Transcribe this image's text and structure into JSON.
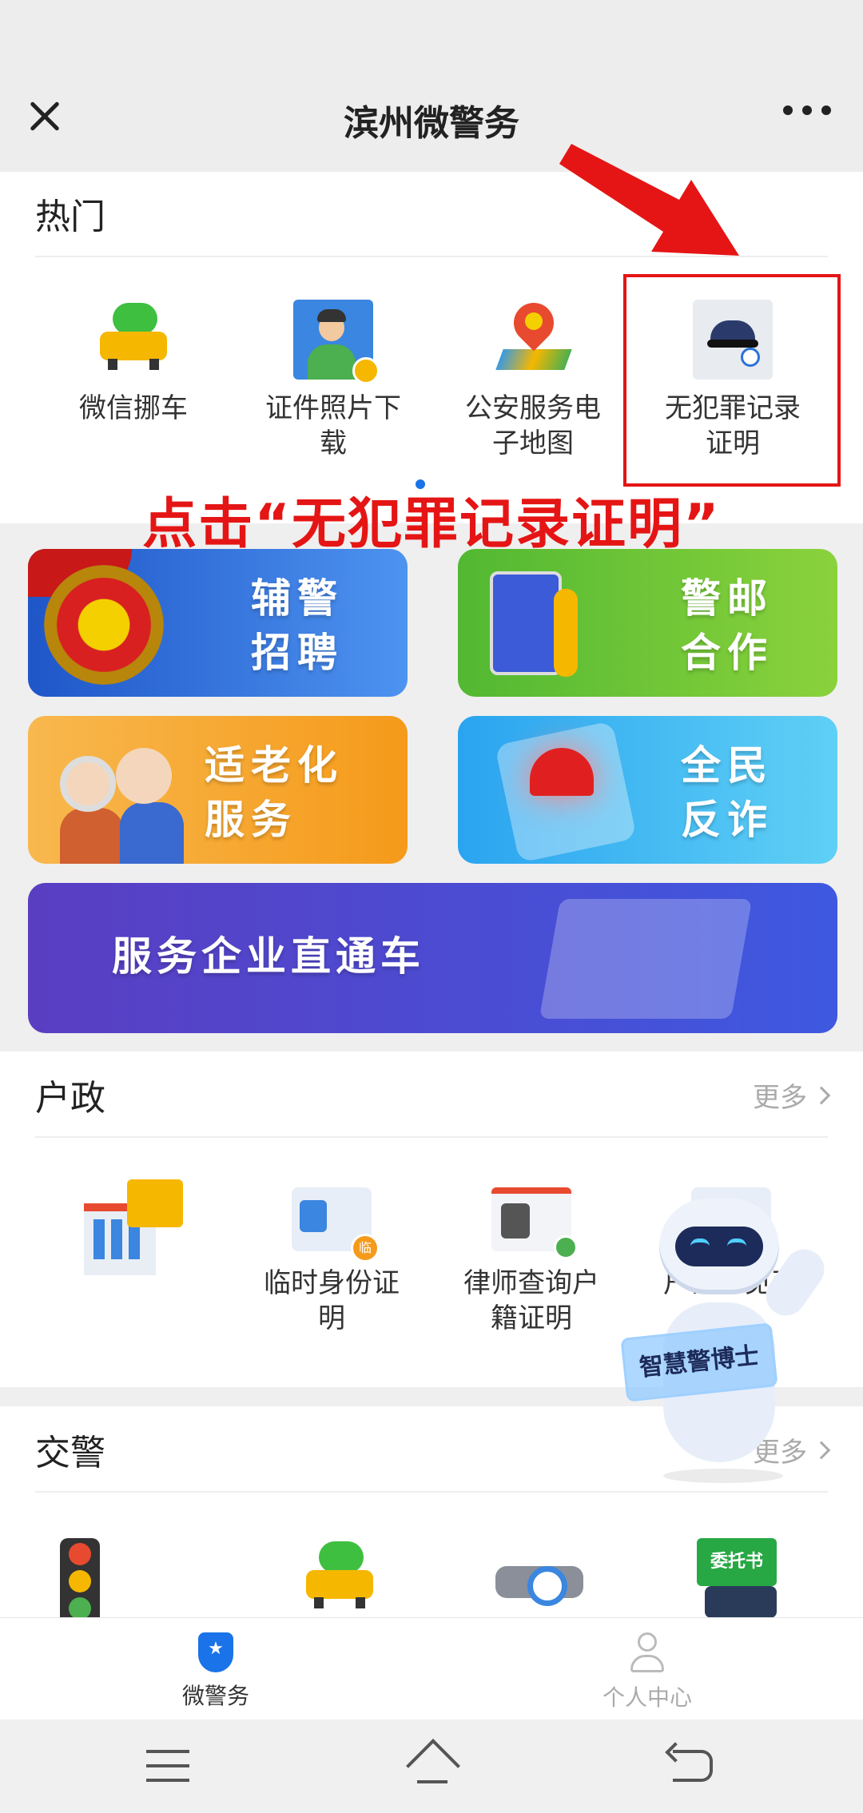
{
  "header": {
    "title": "滨州微警务"
  },
  "hot": {
    "title": "热门",
    "items": [
      {
        "label": "微信挪车",
        "icon": "wechat-car-icon"
      },
      {
        "label": "证件照片下载",
        "icon": "id-photo-download-icon"
      },
      {
        "label": "公安服务电子地图",
        "icon": "police-map-icon"
      },
      {
        "label": "无犯罪记录证明",
        "icon": "no-crime-certificate-icon"
      }
    ]
  },
  "annotation": "点击“无犯罪记录证明”",
  "banners": [
    {
      "line1": "辅警",
      "line2": "招聘"
    },
    {
      "line1": "警邮",
      "line2": "合作"
    },
    {
      "line1": "适老化",
      "line2": "服务"
    },
    {
      "line1": "全民",
      "line2": "反诈"
    },
    {
      "line1": "服务企业直通车"
    }
  ],
  "huzheng": {
    "title": "户政",
    "more": "更多",
    "items": [
      {
        "label": ""
      },
      {
        "label": "临时身份证明",
        "badge": "临"
      },
      {
        "label": "律师查询户籍证明"
      },
      {
        "label": "户口不见面"
      }
    ]
  },
  "robot": {
    "sign": "智慧警博士"
  },
  "jiaojing": {
    "title": "交警",
    "more": "更多",
    "truck_text": "委托书"
  },
  "tabbar": {
    "tabs": [
      {
        "label": "微警务",
        "active": true
      },
      {
        "label": "个人中心",
        "active": false
      }
    ]
  },
  "colors": {
    "accent": "#1a73e8",
    "annotation": "#e51515"
  }
}
